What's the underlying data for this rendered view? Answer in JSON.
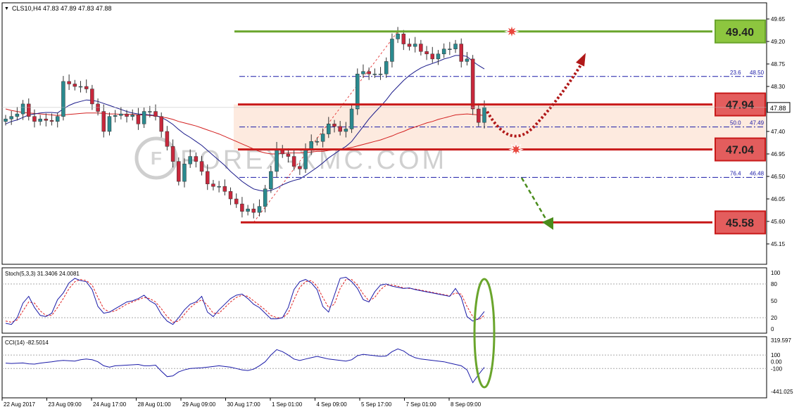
{
  "header": {
    "caret": "▼",
    "label": "CLS10,H4  47.83 47.89 47.83 47.88"
  },
  "watermark": "FOREX-XMC.COM",
  "chart_data": [
    {
      "type": "candlestick",
      "symbol": "CLS10",
      "timeframe": "H4",
      "ohlc": {
        "open": 47.83,
        "high": 47.89,
        "low": 47.83,
        "close": 47.88
      },
      "ylim": [
        45.15,
        49.65
      ],
      "y_ticks": [
        "49.65",
        "49.20",
        "48.75",
        "48.30",
        "47.85",
        "47.40",
        "46.95",
        "46.50",
        "46.05",
        "45.60",
        "45.15"
      ],
      "x_ticks": [
        "22 Aug 2017",
        "23 Aug 09:00",
        "24 Aug 17:00",
        "28 Aug 01:00",
        "29 Aug 09:00",
        "30 Aug 17:00",
        "1 Sep 01:00",
        "4 Sep 09:00",
        "5 Sep 17:00",
        "7 Sep 01:00",
        "8 Sep 09:00"
      ],
      "current_price": "47.88",
      "closes": [
        47.65,
        47.7,
        47.75,
        47.95,
        47.7,
        47.6,
        47.65,
        47.62,
        47.6,
        47.7,
        48.4,
        48.35,
        48.3,
        48.3,
        48.25,
        47.95,
        47.8,
        47.4,
        47.7,
        47.72,
        47.75,
        47.7,
        47.73,
        47.55,
        47.8,
        47.8,
        47.7,
        47.4,
        47.1,
        46.8,
        46.4,
        46.75,
        46.9,
        46.8,
        46.6,
        46.35,
        46.3,
        46.3,
        46.2,
        46.05,
        45.95,
        45.8,
        45.85,
        45.78,
        45.9,
        46.25,
        46.6,
        47.05,
        46.95,
        46.9,
        46.7,
        46.65,
        47.05,
        47.2,
        47.2,
        47.35,
        47.55,
        47.5,
        47.4,
        47.45,
        47.85,
        48.55,
        48.6,
        48.55,
        48.55,
        48.55,
        48.8,
        49.25,
        49.35,
        49.15,
        49.1,
        49.15,
        49.0,
        48.95,
        48.85,
        48.95,
        49.05,
        49.05,
        49.15,
        48.8,
        48.85,
        47.85,
        47.58,
        47.88
      ],
      "ma_fast": [
        47.55,
        47.6,
        47.63,
        47.68,
        47.73,
        47.75,
        47.77,
        47.78,
        47.78,
        47.77,
        47.85,
        47.92,
        47.97,
        48.0,
        48.03,
        48.02,
        48.0,
        47.96,
        47.92,
        47.88,
        47.84,
        47.8,
        47.77,
        47.75,
        47.74,
        47.73,
        47.72,
        47.68,
        47.62,
        47.54,
        47.44,
        47.35,
        47.28,
        47.2,
        47.12,
        47.02,
        46.92,
        46.82,
        46.72,
        46.6,
        46.5,
        46.4,
        46.32,
        46.25,
        46.22,
        46.2,
        46.22,
        46.27,
        46.33,
        46.38,
        46.42,
        46.45,
        46.52,
        46.6,
        46.68,
        46.77,
        46.87,
        46.95,
        47.03,
        47.1,
        47.2,
        47.35,
        47.5,
        47.65,
        47.78,
        47.9,
        48.03,
        48.18,
        48.3,
        48.42,
        48.52,
        48.6,
        48.67,
        48.72,
        48.76,
        48.8,
        48.85,
        48.88,
        48.92,
        48.92,
        48.9,
        48.8,
        48.72,
        48.65
      ],
      "ma_slow": [
        47.85,
        47.82,
        47.8,
        47.78,
        47.77,
        47.76,
        47.75,
        47.74,
        47.73,
        47.72,
        47.73,
        47.74,
        47.75,
        47.76,
        47.77,
        47.77,
        47.77,
        47.76,
        47.75,
        47.75,
        47.74,
        47.74,
        47.74,
        47.73,
        47.73,
        47.72,
        47.71,
        47.69,
        47.67,
        47.64,
        47.6,
        47.57,
        47.54,
        47.51,
        47.47,
        47.43,
        47.39,
        47.35,
        47.3,
        47.25,
        47.2,
        47.15,
        47.1,
        47.05,
        47.0,
        46.97,
        46.95,
        46.95,
        46.96,
        46.97,
        46.97,
        46.97,
        46.98,
        46.99,
        47.0,
        47.0,
        47.02,
        47.03,
        47.04,
        47.06,
        47.08,
        47.11,
        47.14,
        47.17,
        47.2,
        47.23,
        47.27,
        47.31,
        47.36,
        47.4,
        47.45,
        47.49,
        47.53,
        47.57,
        47.6,
        47.64,
        47.67,
        47.7,
        47.73,
        47.74,
        47.75,
        47.74,
        47.73,
        47.72
      ],
      "levels": [
        {
          "price": "49.40",
          "color": "#6aa52c",
          "label_bg": "#8dc63f"
        },
        {
          "price": "47.94",
          "color": "#c81a1a",
          "label_bg": "#e35d5d"
        },
        {
          "price": "47.04",
          "color": "#c81a1a",
          "label_bg": "#e35d5d"
        },
        {
          "price": "45.58",
          "color": "#c81a1a",
          "label_bg": "#e35d5d"
        }
      ],
      "fibonacci": [
        {
          "ratio": "23.6",
          "price": "48.50"
        },
        {
          "ratio": "50.0",
          "price": "47.49"
        },
        {
          "ratio": "76.4",
          "price": "46.48"
        }
      ]
    },
    {
      "type": "line",
      "indicator": "Stoch(5,3,3)",
      "label": "Stoch(5,3,3) 31.3406 24.0081",
      "ylim": [
        0,
        100
      ],
      "y_ticks": [
        "100",
        "80",
        "50",
        "20",
        "0"
      ],
      "main": [
        10,
        8,
        20,
        46,
        58,
        38,
        24,
        22,
        28,
        52,
        64,
        82,
        90,
        86,
        84,
        70,
        40,
        28,
        30,
        36,
        42,
        48,
        50,
        54,
        60,
        50,
        44,
        26,
        14,
        8,
        20,
        34,
        44,
        48,
        58,
        30,
        22,
        34,
        44,
        54,
        60,
        62,
        54,
        44,
        38,
        28,
        18,
        18,
        20,
        38,
        70,
        84,
        88,
        82,
        70,
        40,
        30,
        60,
        90,
        92,
        84,
        72,
        52,
        48,
        66,
        78,
        80,
        76,
        74,
        72,
        73,
        70,
        68,
        66,
        64,
        62,
        60,
        58,
        72,
        56,
        22,
        14,
        18,
        31
      ],
      "signal": [
        14,
        12,
        16,
        32,
        48,
        46,
        32,
        24,
        24,
        38,
        54,
        72,
        84,
        88,
        86,
        78,
        56,
        36,
        30,
        32,
        38,
        44,
        48,
        52,
        56,
        54,
        48,
        36,
        22,
        12,
        14,
        26,
        38,
        46,
        52,
        42,
        28,
        28,
        38,
        48,
        56,
        60,
        58,
        50,
        42,
        34,
        24,
        20,
        20,
        28,
        52,
        74,
        84,
        86,
        76,
        56,
        38,
        44,
        72,
        88,
        88,
        78,
        62,
        50,
        56,
        70,
        78,
        78,
        76,
        73,
        72,
        71,
        69,
        67,
        65,
        63,
        61,
        59,
        64,
        62,
        40,
        22,
        16,
        24
      ]
    },
    {
      "type": "line",
      "indicator": "CCI(14)",
      "label": "CCI(14) -82.5014",
      "ylim": [
        -441.025,
        319.597
      ],
      "y_ticks": [
        "319.597",
        "100",
        "0.00",
        "-100",
        "-441.025"
      ],
      "values": [
        -20,
        -25,
        -22,
        -18,
        -30,
        -35,
        -20,
        -10,
        0,
        12,
        20,
        15,
        10,
        30,
        40,
        30,
        0,
        -60,
        -80,
        -60,
        -55,
        -50,
        -45,
        -40,
        -60,
        -60,
        -50,
        -140,
        -220,
        -210,
        -150,
        -120,
        -100,
        -95,
        -90,
        -80,
        -70,
        -60,
        -70,
        -80,
        -100,
        -120,
        -130,
        -110,
        -60,
        0,
        100,
        180,
        150,
        100,
        40,
        20,
        40,
        60,
        80,
        60,
        40,
        30,
        20,
        10,
        30,
        90,
        110,
        100,
        90,
        80,
        85,
        150,
        190,
        160,
        100,
        60,
        40,
        30,
        20,
        10,
        0,
        -20,
        -40,
        -60,
        -120,
        -310,
        -190,
        -82
      ]
    }
  ]
}
